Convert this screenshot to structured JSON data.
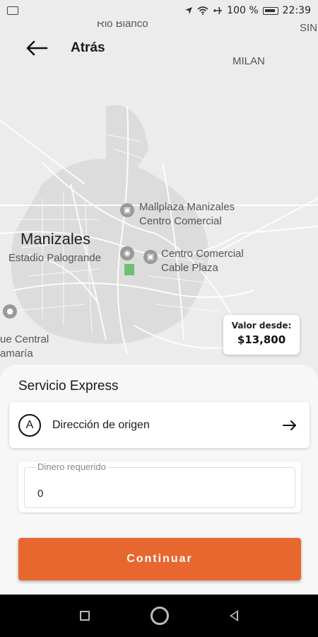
{
  "status_bar": {
    "battery": "100 %",
    "time": "22:39"
  },
  "header": {
    "title": "Atrás"
  },
  "map": {
    "labels": {
      "rio_blanco": "Rio Blanco",
      "sin": "SIN",
      "milan": "MILAN",
      "manizales": "Manizales",
      "estadio": "Estadio Palogrande",
      "mallplaza_line1": "Mallplaza Manizales",
      "mallplaza_line2": "Centro Comercial",
      "cable_line1": "Centro Comercial",
      "cable_line2": "Cable Plaza",
      "central_line1": "ue Central",
      "central_line2": "amaría"
    }
  },
  "price_card": {
    "label": "Valor desde:",
    "value": "$13,800"
  },
  "sheet": {
    "title": "Servicio Express",
    "origin": {
      "badge": "A",
      "label": "Dirección de origen"
    },
    "money": {
      "label": "Dinero requerido",
      "value": "0"
    },
    "continue_label": "Continuar"
  },
  "colors": {
    "accent": "#e8672f",
    "poi_green": "#6fbf73"
  },
  "icons": [
    "back-arrow-icon",
    "right-arrow-icon",
    "wifi-icon",
    "airplane-icon",
    "location-icon",
    "battery-icon"
  ]
}
